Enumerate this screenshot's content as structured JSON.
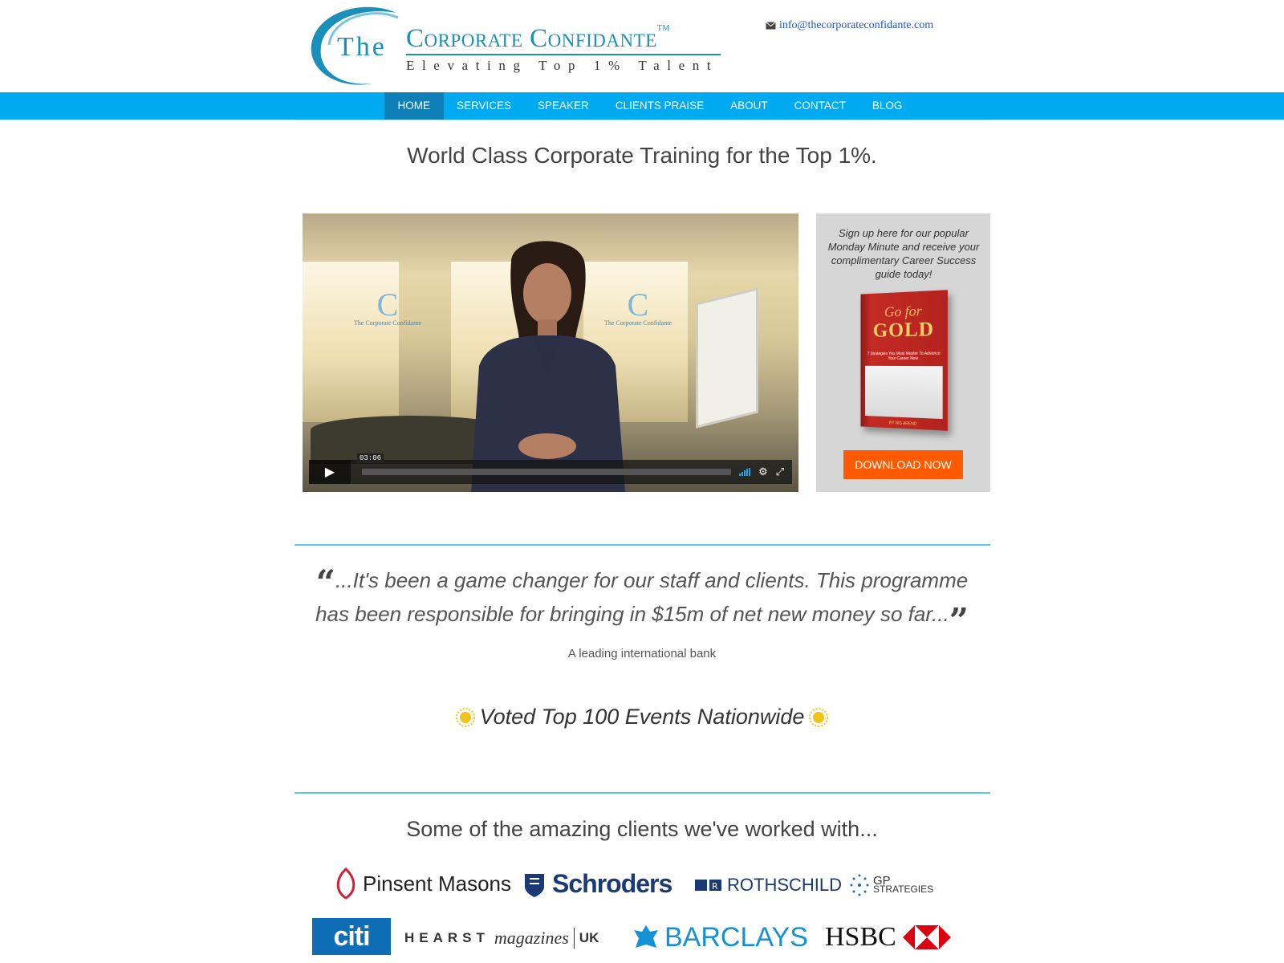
{
  "header": {
    "logo": {
      "the": "The",
      "name": "Corporate Confidante",
      "tm": "TM",
      "tagline": "Elevating Top 1% Talent"
    },
    "email": "info@thecorporateconfidante.com",
    "email_icon": "envelope-icon"
  },
  "nav": {
    "items": [
      {
        "label": "Home",
        "active": true
      },
      {
        "label": "Services"
      },
      {
        "label": "Speaker"
      },
      {
        "label": "Clients Praise"
      },
      {
        "label": "About"
      },
      {
        "label": "Contact"
      },
      {
        "label": "Blog"
      }
    ],
    "bar_color": "#00aaf0",
    "active_color": "#0f7fb8"
  },
  "hero": {
    "headline": "World Class Corporate Training for the Top 1%."
  },
  "video": {
    "time": "03:06",
    "watermark_text": "The Corporate Confidante",
    "play_icon": "play-icon",
    "volume_icon": "volume-bars-icon",
    "settings_icon": "gear-icon",
    "fullscreen_icon": "fullscreen-icon"
  },
  "signup": {
    "text": "Sign up here for our popular Monday Minute and receive your complimentary Career Success guide today!",
    "book": {
      "title_line1": "Go for",
      "title_line2": "GOLD",
      "subtitle": "7 Strategies You Must Master To Advance Your Career Now",
      "author": "BY NIS AREND"
    },
    "button_label": "Download Now",
    "button_color": "#ff5a00"
  },
  "testimonial": {
    "quote": "...It's been a game changer for our staff and clients. This programme has been responsible for bringing in $15m of net new money so far...",
    "source": "A leading international bank"
  },
  "award": {
    "text": "Voted Top 100 Events Nationwide",
    "icon": "sun-badge-icon"
  },
  "clients": {
    "title": "Some of the amazing clients we've worked with...",
    "logos": {
      "pinsent": "Pinsent Masons",
      "schroders": "Schroders",
      "rothschild": "ROTHSCHILD",
      "gp_line1": "GP",
      "gp_line2": "STRATEGIES",
      "citi": "citi",
      "hearst": "HEARST",
      "hearst_mag": "magazines",
      "hearst_uk": "UK",
      "barclays": "BARCLAYS",
      "hsbc": "HSBC"
    }
  }
}
